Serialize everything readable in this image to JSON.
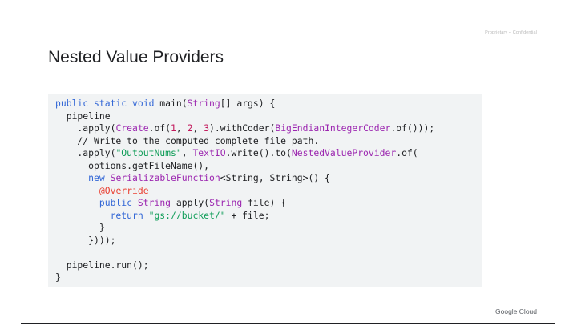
{
  "header": {
    "confidential_label": "Proprietary + Confidential",
    "title": "Nested Value Providers"
  },
  "footer": {
    "logo_text": "Google Cloud"
  },
  "code": {
    "l1": [
      "public static void",
      " main(",
      "String",
      "[] args) {"
    ],
    "l2": [
      "  pipeline"
    ],
    "l3": [
      "    .apply(",
      "Create",
      ".of(",
      "1",
      ", ",
      "2",
      ", ",
      "3",
      ").withCoder(",
      "BigEndianIntegerCoder",
      ".of()));"
    ],
    "l4": [
      "    // Write to the computed complete file path."
    ],
    "l5": [
      "    .apply(",
      "\"OutputNums\"",
      ", ",
      "TextIO",
      ".write().to(",
      "NestedValueProvider",
      ".of("
    ],
    "l6": [
      "      options.getFileName(),"
    ],
    "l7": [
      "      ",
      "new",
      " ",
      "SerializableFunction",
      "<String, String>() {"
    ],
    "l8": [
      "        ",
      "@Override"
    ],
    "l9": [
      "        ",
      "public",
      " ",
      "String",
      " apply(",
      "String",
      " file) {"
    ],
    "l10": [
      "          ",
      "return",
      " ",
      "\"gs://bucket/\"",
      " + file;"
    ],
    "l11": [
      "        }"
    ],
    "l12": [
      "      })));"
    ],
    "l13": [
      ""
    ],
    "l14": [
      "  pipeline.run();"
    ],
    "l15": [
      "}"
    ]
  },
  "colors": {
    "keyword": "#3367d6",
    "type": "#9c27b0",
    "number": "#c2185b",
    "string": "#0f9d58",
    "annotation": "#ea4335",
    "code_background": "#f1f3f4"
  }
}
